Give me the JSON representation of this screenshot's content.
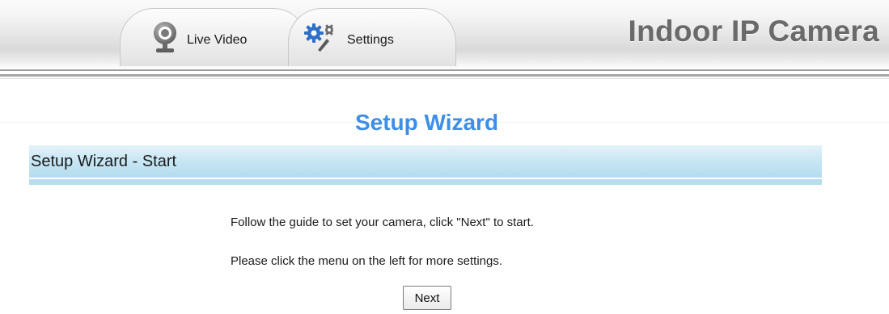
{
  "header": {
    "tabs": [
      {
        "label": "Live Video",
        "icon": "webcam-icon"
      },
      {
        "label": "Settings",
        "icon": "gears-wrench-icon"
      }
    ],
    "brand_title": "Indoor IP Camera"
  },
  "main": {
    "page_title": "Setup Wizard",
    "section_title": "Setup Wizard - Start",
    "guide_lines": [
      "Follow the guide to set your camera, click \"Next\" to start.",
      "Please click the menu on the left for more settings."
    ],
    "next_label": "Next"
  },
  "colors": {
    "title_blue": "#3d8ee6",
    "section_bar": "#c9e7f4",
    "brand_gray": "#6a6a6a"
  }
}
